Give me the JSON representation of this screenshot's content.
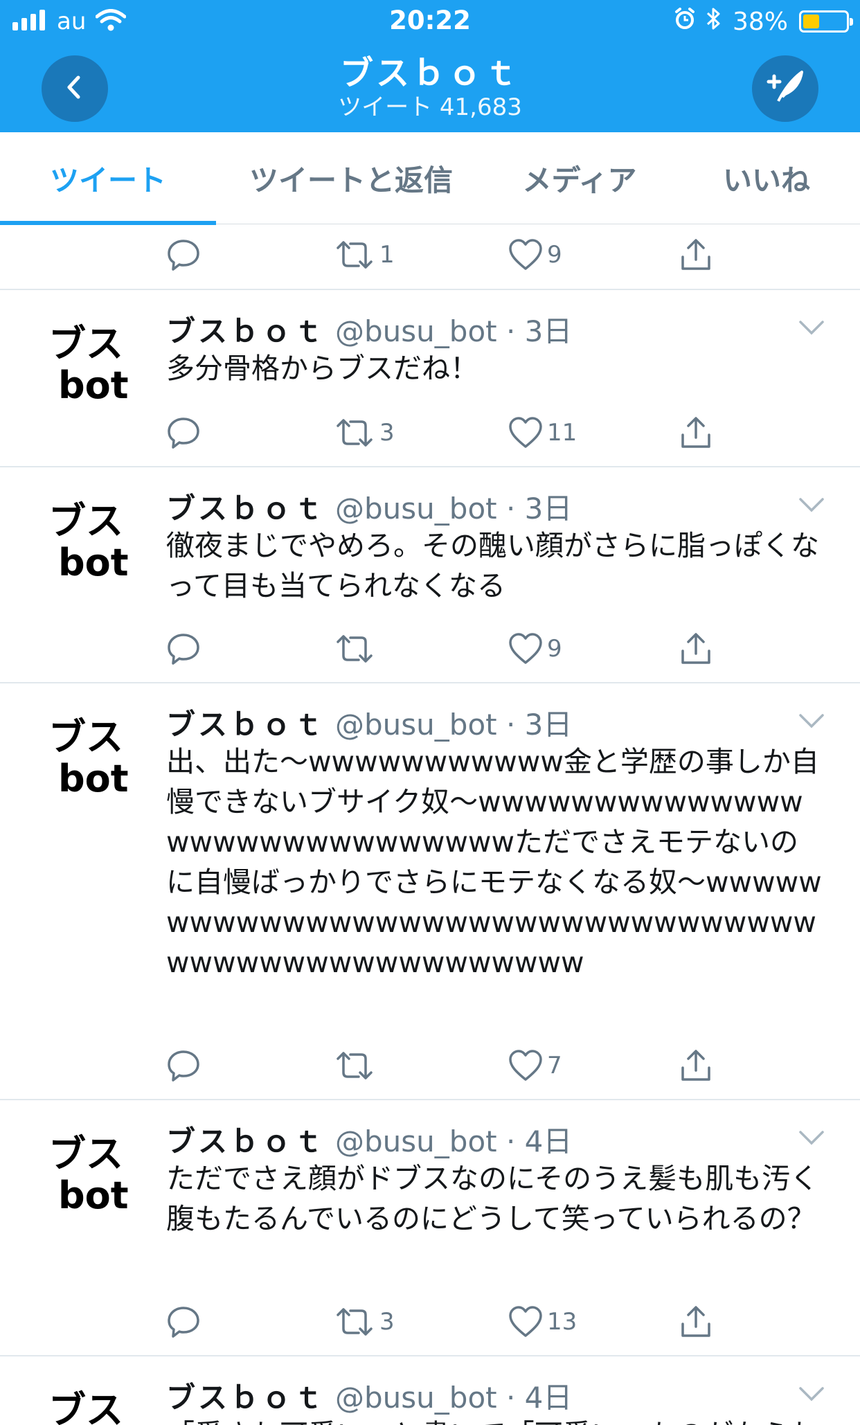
{
  "status_bar": {
    "carrier": "au",
    "time": "20:22",
    "battery_percent": "38%",
    "battery_level": 0.38,
    "battery_color": "#ffcc00"
  },
  "header": {
    "title": "ブスｂｏｔ",
    "tweet_count": "ツイート 41,683",
    "accent_color": "#1da1f2"
  },
  "tabs": [
    {
      "label": "ツイート",
      "active": true
    },
    {
      "label": "ツイートと返信",
      "active": false
    },
    {
      "label": "メディア",
      "active": false
    },
    {
      "label": "いいね",
      "active": false
    }
  ],
  "avatar": {
    "line1": "ブス",
    "line2": "bot"
  },
  "tweets": [
    {
      "name": "",
      "handle": "",
      "text": "",
      "reply_count": "",
      "retweet_count": "1",
      "like_count": "9"
    },
    {
      "name": "ブスｂｏｔ",
      "handle": "@busu_bot · 3日",
      "text": "多分骨格からブスだね！",
      "retweet_count": "3",
      "like_count": "11"
    },
    {
      "name": "ブスｂｏｔ",
      "handle": "@busu_bot · 3日",
      "text": "徹夜まじでやめろ。その醜い顔がさらに脂っぽくなって目も当てられなくなる",
      "retweet_count": "",
      "like_count": "9"
    },
    {
      "name": "ブスｂｏｔ",
      "handle": "@busu_bot · 3日",
      "text": "出、出た〜wwwwwwwwwww金と学歴の事しか自慢できないブサイク奴〜wwwwwwwwwwwwwwwwwwwwwwwwwwwwwただでさえモテないのに自慢ばっかりでさらにモテなくなる奴〜wwwwwwwwwwwwwwwwwwwwwwwwwwwwwwwwwwwwwwwwwwwwwwwwwww",
      "retweet_count": "",
      "like_count": "7"
    },
    {
      "name": "ブスｂｏｔ",
      "handle": "@busu_bot · 4日",
      "text": "ただでさえ顔がドブスなのにそのうえ髪も肌も汚く腹もたるんでいるのにどうして笑っていられるの？",
      "retweet_count": "3",
      "like_count": "13"
    },
    {
      "name": "ブスｂｏｔ",
      "handle": "@busu_bot · 4日",
      "text": "「愛され可愛い」と書いて「可愛い」ものがなられ",
      "retweet_count": "",
      "like_count": ""
    }
  ]
}
